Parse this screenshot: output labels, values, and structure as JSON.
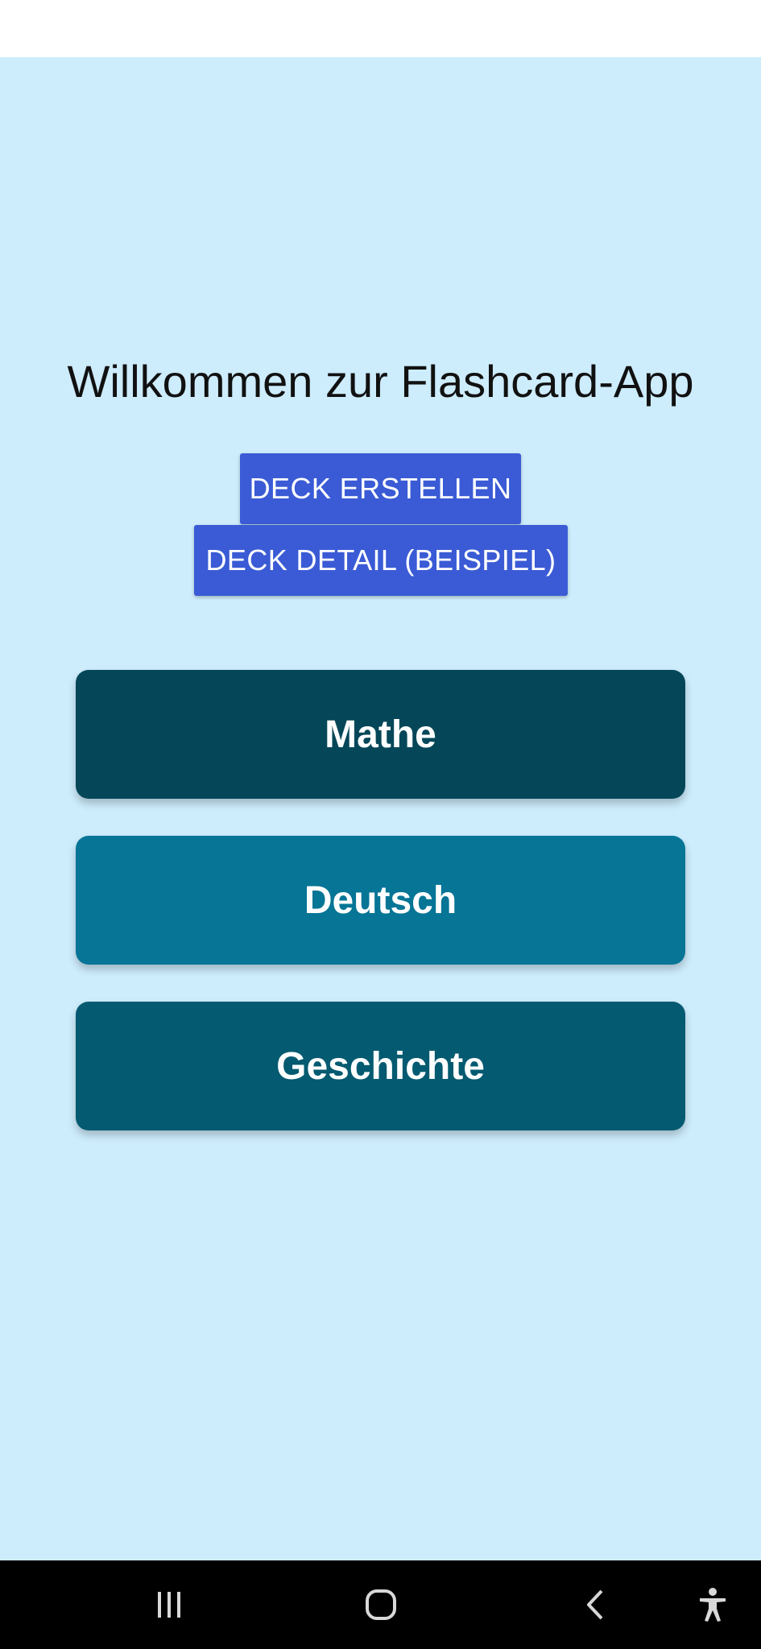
{
  "app": {
    "title": "Willkommen zur Flashcard-App",
    "background_color": "#cdecfc"
  },
  "actions": {
    "create_deck_label": "DECK ERSTELLEN",
    "deck_detail_label": "DECK DETAIL (BEISPIEL)",
    "button_color": "#3a5bd5"
  },
  "decks": [
    {
      "name": "Mathe",
      "color": "#054759"
    },
    {
      "name": "Deutsch",
      "color": "#067596"
    },
    {
      "name": "Geschichte",
      "color": "#045a70"
    }
  ],
  "navigation": {
    "icons": [
      "recent-apps-icon",
      "home-icon",
      "back-icon",
      "accessibility-icon"
    ]
  }
}
